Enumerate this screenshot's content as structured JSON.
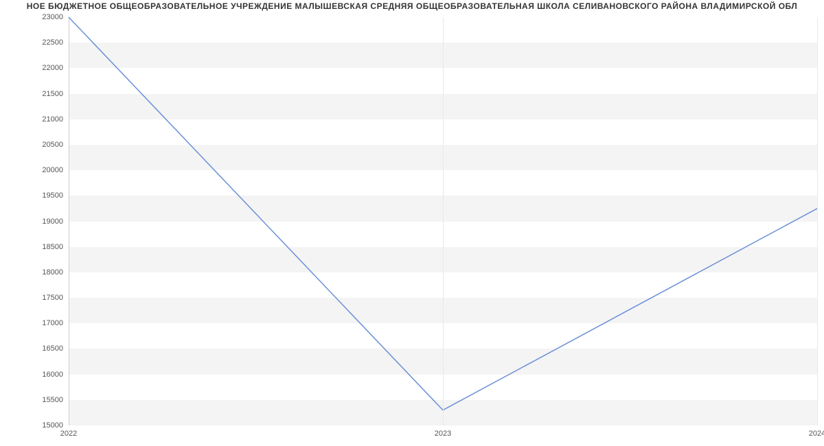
{
  "chart_data": {
    "type": "line",
    "title": "НОЕ БЮДЖЕТНОЕ ОБЩЕОБРАЗОВАТЕЛЬНОЕ УЧРЕЖДЕНИЕ МАЛЫШЕВСКАЯ СРЕДНЯЯ ОБЩЕОБРАЗОВАТЕЛЬНАЯ ШКОЛА СЕЛИВАНОВСКОГО РАЙОНА ВЛАДИМИРСКОЙ ОБЛ",
    "x": [
      2022,
      2023,
      2024
    ],
    "values": [
      23000,
      15300,
      19250
    ],
    "xlabel": "",
    "ylabel": "",
    "xlim": [
      2022,
      2024
    ],
    "ylim": [
      15000,
      23000
    ],
    "y_ticks": [
      15000,
      15500,
      16000,
      16500,
      17000,
      17500,
      18000,
      18500,
      19000,
      19500,
      20000,
      20500,
      21000,
      21500,
      22000,
      22500,
      23000
    ],
    "x_ticks": [
      2022,
      2023,
      2024
    ],
    "line_color": "#6a8fd8"
  }
}
